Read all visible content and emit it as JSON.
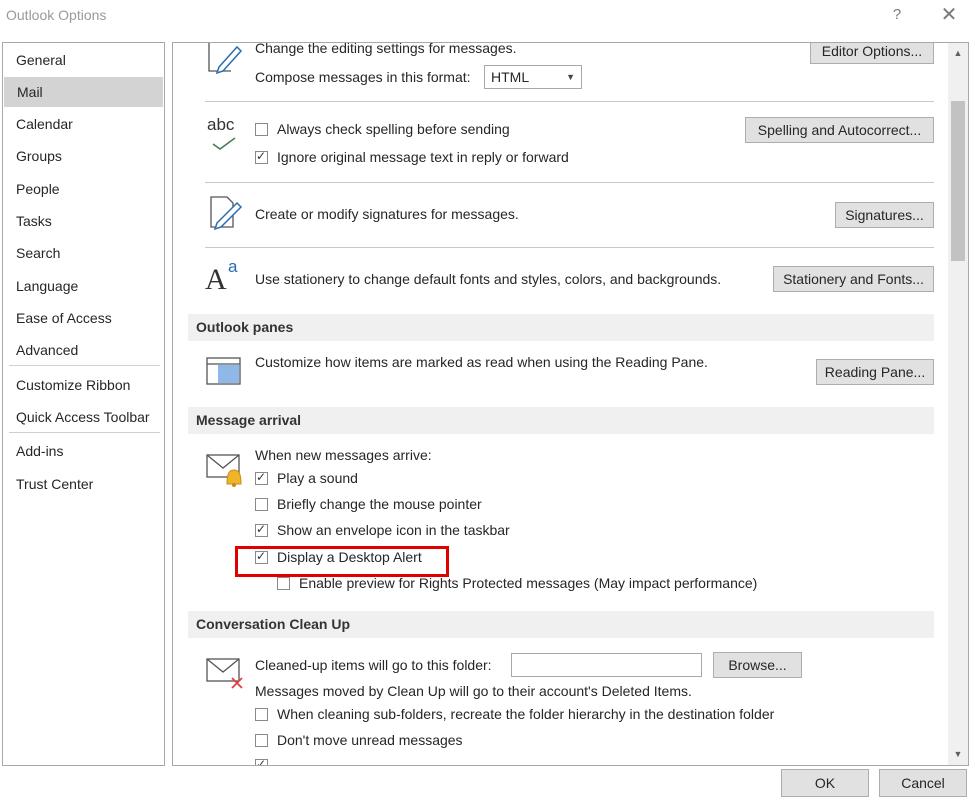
{
  "window": {
    "title": "Outlook Options",
    "help": "?",
    "close": "✕"
  },
  "nav": {
    "items": [
      {
        "label": "General"
      },
      {
        "label": "Mail"
      },
      {
        "label": "Calendar"
      },
      {
        "label": "Groups"
      },
      {
        "label": "People"
      },
      {
        "label": "Tasks"
      },
      {
        "label": "Search"
      },
      {
        "label": "Language"
      },
      {
        "label": "Ease of Access"
      },
      {
        "label": "Advanced"
      },
      {
        "label": "Customize Ribbon"
      },
      {
        "label": "Quick Access Toolbar"
      },
      {
        "label": "Add-ins"
      },
      {
        "label": "Trust Center"
      }
    ],
    "selected": "Mail"
  },
  "compose": {
    "text": "Change the editing settings for messages.",
    "editor_btn": "Editor Options...",
    "format_label": "Compose messages in this format:",
    "format_value": "HTML"
  },
  "spelling": {
    "icon_text": "abc",
    "always_check": "Always check spelling before sending",
    "ignore_original": "Ignore original message text in reply or forward",
    "btn": "Spelling and Autocorrect..."
  },
  "signatures": {
    "text": "Create or modify signatures for messages.",
    "btn": "Signatures..."
  },
  "stationery": {
    "text": "Use stationery to change default fonts and styles, colors, and backgrounds.",
    "btn": "Stationery and Fonts..."
  },
  "outlook_panes": {
    "header": "Outlook panes",
    "text": "Customize how items are marked as read when using the Reading Pane.",
    "btn": "Reading Pane..."
  },
  "message_arrival": {
    "header": "Message arrival",
    "intro": "When new messages arrive:",
    "play_sound": "Play a sound",
    "change_pointer": "Briefly change the mouse pointer",
    "envelope_icon": "Show an envelope icon in the taskbar",
    "desktop_alert": "Display a Desktop Alert",
    "rights_preview": "Enable preview for Rights Protected messages (May impact performance)"
  },
  "cleanup": {
    "header": "Conversation Clean Up",
    "folder_label": "Cleaned-up items will go to this folder:",
    "folder_value": "",
    "browse_btn": "Browse...",
    "moved_text": "Messages moved by Clean Up will go to their account's Deleted Items.",
    "recreate_hierarchy": "When cleaning sub-folders, recreate the folder hierarchy in the destination folder",
    "dont_move_unread": "Don't move unread messages"
  },
  "footer": {
    "ok": "OK",
    "cancel": "Cancel"
  }
}
